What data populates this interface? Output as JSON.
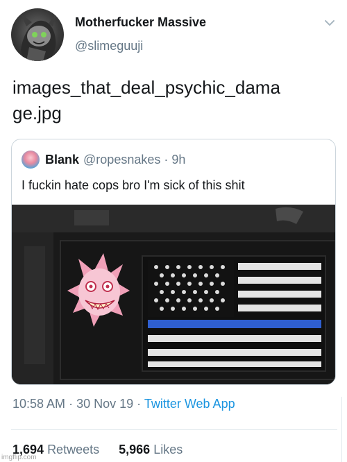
{
  "author": {
    "display_name": "Motherfucker Massive",
    "handle": "@slimeguuji"
  },
  "tweet": {
    "text": "images_that_deal_psychic_damage.jpg"
  },
  "quoted_tweet": {
    "display_name": "Blank",
    "handle": "@ropesnakes",
    "separator": "·",
    "time_ago": "9h",
    "text": "I fuckin hate cops bro I'm sick of this shit"
  },
  "meta": {
    "time": "10:58 AM",
    "separator": "·",
    "date": "30 Nov 19",
    "source": "Twitter Web App"
  },
  "stats": {
    "retweets_count": "1,694",
    "retweets_label": "Retweets",
    "likes_count": "5,966",
    "likes_label": "Likes"
  },
  "watermark": "imgflip.com",
  "colors": {
    "link_blue": "#1b95e0",
    "muted_gray": "#657786",
    "text_dark": "#14171a",
    "border": "#ccd6dd"
  },
  "icons": {
    "menu": "chevron-down-icon"
  }
}
